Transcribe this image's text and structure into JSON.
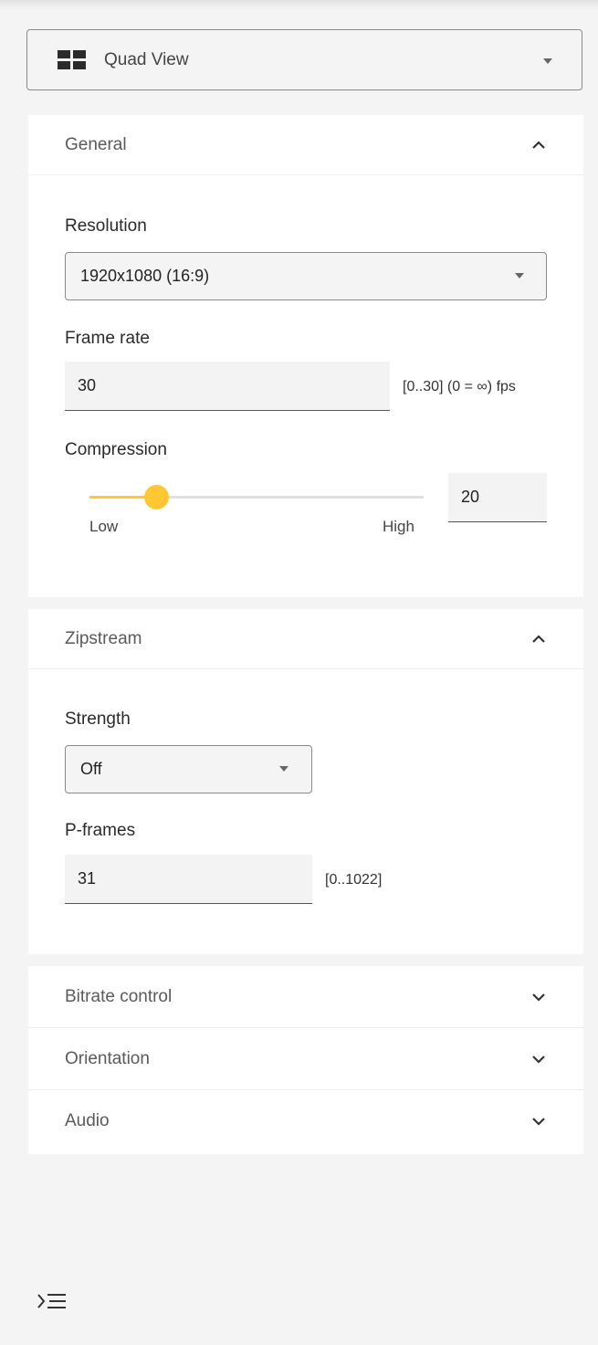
{
  "view_selector": {
    "label": "Quad View",
    "icon": "quad-view-icon"
  },
  "general": {
    "title": "General",
    "expanded": true,
    "resolution": {
      "label": "Resolution",
      "value": "1920x1080 (16:9)"
    },
    "frame_rate": {
      "label": "Frame rate",
      "value": "30",
      "hint": "[0..30] (0 = ∞) fps"
    },
    "compression": {
      "label": "Compression",
      "value": "20",
      "min_label": "Low",
      "max_label": "High",
      "level_percent": 20
    }
  },
  "zipstream": {
    "title": "Zipstream",
    "expanded": true,
    "strength": {
      "label": "Strength",
      "value": "Off"
    },
    "p_frames": {
      "label": "P-frames",
      "value": "31",
      "hint": "[0..1022]"
    }
  },
  "collapsed_sections": [
    {
      "title": "Bitrate control"
    },
    {
      "title": "Orientation"
    },
    {
      "title": "Audio"
    }
  ],
  "colors": {
    "accent": "#ffc732",
    "panel_bg": "#ffffff",
    "page_bg": "#f4f4f4"
  }
}
